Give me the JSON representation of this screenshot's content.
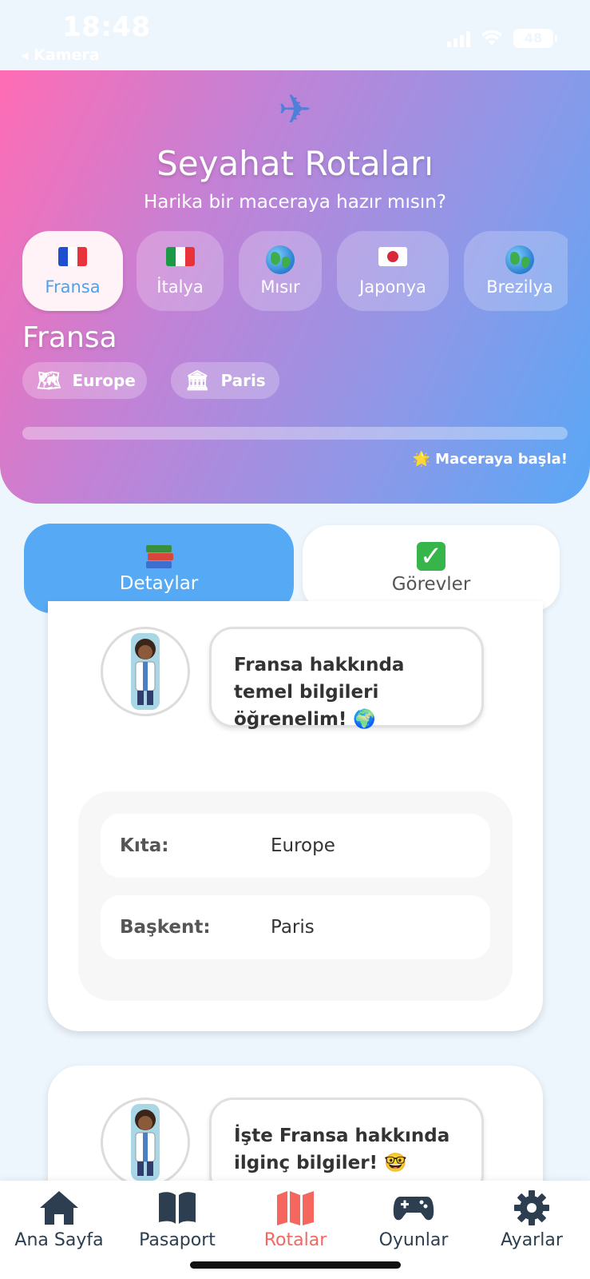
{
  "status_bar": {
    "time": "18:48",
    "back_label": "◂ Kamera",
    "battery": "48"
  },
  "hero": {
    "plane_icon": "✈",
    "title": "Seyahat Rotaları",
    "subtitle": "Harika bir maceraya hazır mısın?",
    "countries": [
      {
        "label": "Fransa",
        "icon": "flag-france",
        "active": true
      },
      {
        "label": "İtalya",
        "icon": "flag-italy",
        "active": false
      },
      {
        "label": "Mısır",
        "icon": "globe-icon",
        "active": false
      },
      {
        "label": "Japonya",
        "icon": "flag-japan",
        "active": false
      },
      {
        "label": "Brezilya",
        "icon": "globe-icon",
        "active": false
      }
    ],
    "selected_country": "Fransa",
    "continent_pill": "Europe",
    "capital_pill": "Paris",
    "progress": 0,
    "cta": "🌟 Maceraya başla!"
  },
  "tabs": {
    "details_label": "Detaylar",
    "tasks_label": "Görevler",
    "active": "details"
  },
  "cards": {
    "basics_message": "Fransa hakkında temel bilgileri öğrenelim! 🌍",
    "facts": [
      {
        "label": "Kıta:",
        "value": "Europe"
      },
      {
        "label": "Başkent:",
        "value": "Paris"
      }
    ],
    "fun_facts_message": "İşte Fransa hakkında ilginç bilgiler! 🤓"
  },
  "bottom_nav": {
    "items": [
      {
        "label": "Ana Sayfa",
        "icon": "home-icon"
      },
      {
        "label": "Pasaport",
        "icon": "book-icon"
      },
      {
        "label": "Rotalar",
        "icon": "map-icon"
      },
      {
        "label": "Oyunlar",
        "icon": "gamepad-icon"
      },
      {
        "label": "Ayarlar",
        "icon": "gear-icon"
      }
    ],
    "active": "Rotalar"
  },
  "colors": {
    "accent_blue": "#56aaf5",
    "active_nav": "#f4665e",
    "nav_text": "#2c3e50",
    "gradient_start": "#ff6cb4",
    "gradient_end": "#58a8f6"
  }
}
